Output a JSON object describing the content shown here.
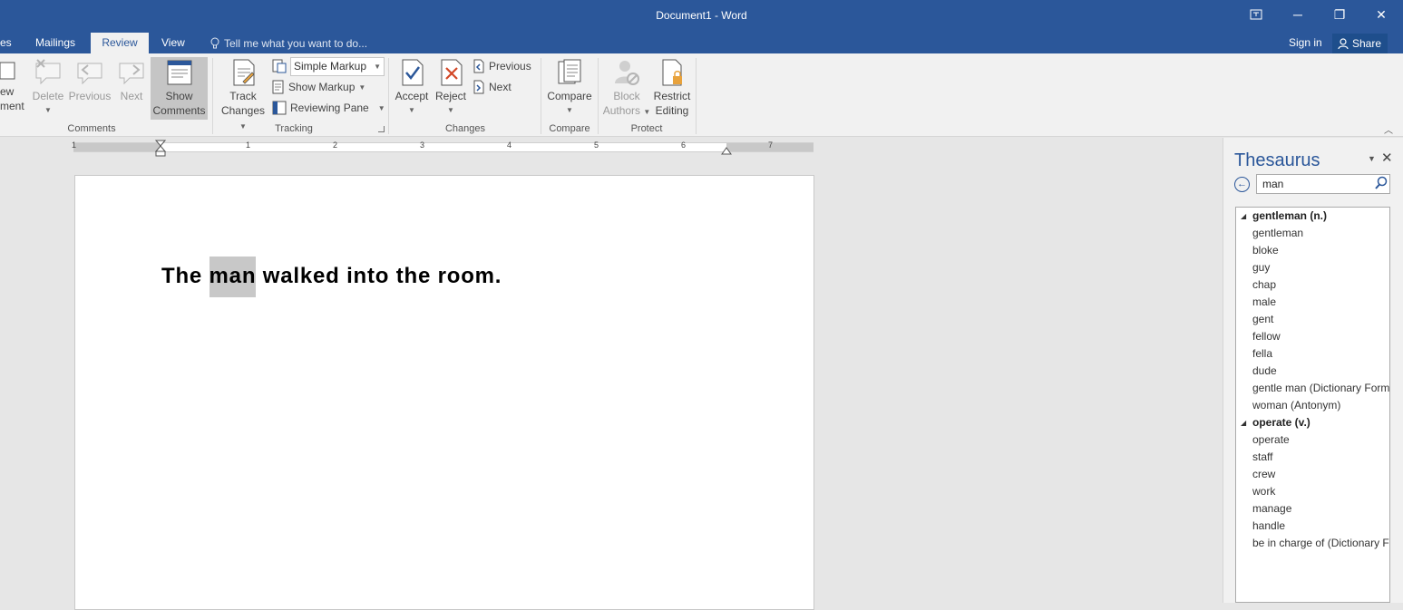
{
  "window": {
    "title": "Document1 - Word",
    "controls": {
      "options_icon": "ribbon-display-icon",
      "minimize": "─",
      "restore": "❐",
      "close": "✕"
    }
  },
  "tabs": {
    "references_partial": "es",
    "mailings": "Mailings",
    "review": "Review",
    "view": "View",
    "tell_me": "Tell me what you want to do...",
    "sign_in": "Sign in",
    "share": "Share"
  },
  "ribbon": {
    "comments": {
      "new_comment_line1": "ew",
      "new_comment_line2": "ment",
      "delete": "Delete",
      "previous": "Previous",
      "next": "Next",
      "show_comments_line1": "Show",
      "show_comments_line2": "Comments",
      "group_label": "Comments"
    },
    "tracking": {
      "track_changes_line1": "Track",
      "track_changes_line2": "Changes",
      "markup_select": "Simple Markup",
      "show_markup": "Show Markup",
      "reviewing_pane": "Reviewing Pane",
      "group_label": "Tracking"
    },
    "changes": {
      "accept": "Accept",
      "reject": "Reject",
      "previous": "Previous",
      "next": "Next",
      "group_label": "Changes"
    },
    "compare": {
      "compare": "Compare",
      "group_label": "Compare"
    },
    "protect": {
      "block_authors_line1": "Block",
      "block_authors_line2": "Authors",
      "restrict_editing_line1": "Restrict",
      "restrict_editing_line2": "Editing",
      "group_label": "Protect"
    }
  },
  "ruler": {
    "numbers": [
      "1",
      "1",
      "2",
      "3",
      "4",
      "5",
      "6",
      "7"
    ]
  },
  "document": {
    "before": "The ",
    "highlighted": "man",
    "after": " walked into the room."
  },
  "thesaurus": {
    "title": "Thesaurus",
    "search_value": "man",
    "results": [
      {
        "text": "gentleman (n.)",
        "head": true
      },
      {
        "text": "gentleman",
        "head": false
      },
      {
        "text": "bloke",
        "head": false
      },
      {
        "text": "guy",
        "head": false
      },
      {
        "text": "chap",
        "head": false
      },
      {
        "text": "male",
        "head": false
      },
      {
        "text": "gent",
        "head": false
      },
      {
        "text": "fellow",
        "head": false
      },
      {
        "text": "fella",
        "head": false
      },
      {
        "text": "dude",
        "head": false
      },
      {
        "text": "gentle man (Dictionary Form)",
        "head": false
      },
      {
        "text": "woman (Antonym)",
        "head": false
      },
      {
        "text": "operate (v.)",
        "head": true
      },
      {
        "text": "operate",
        "head": false
      },
      {
        "text": "staff",
        "head": false
      },
      {
        "text": "crew",
        "head": false
      },
      {
        "text": "work",
        "head": false
      },
      {
        "text": "manage",
        "head": false
      },
      {
        "text": "handle",
        "head": false
      },
      {
        "text": "be in charge of (Dictionary Form)",
        "head": false
      }
    ]
  },
  "colors": {
    "word_blue": "#2b579a",
    "ribbon_bg": "#f1f1f1",
    "highlight": "#c8c8c8"
  }
}
